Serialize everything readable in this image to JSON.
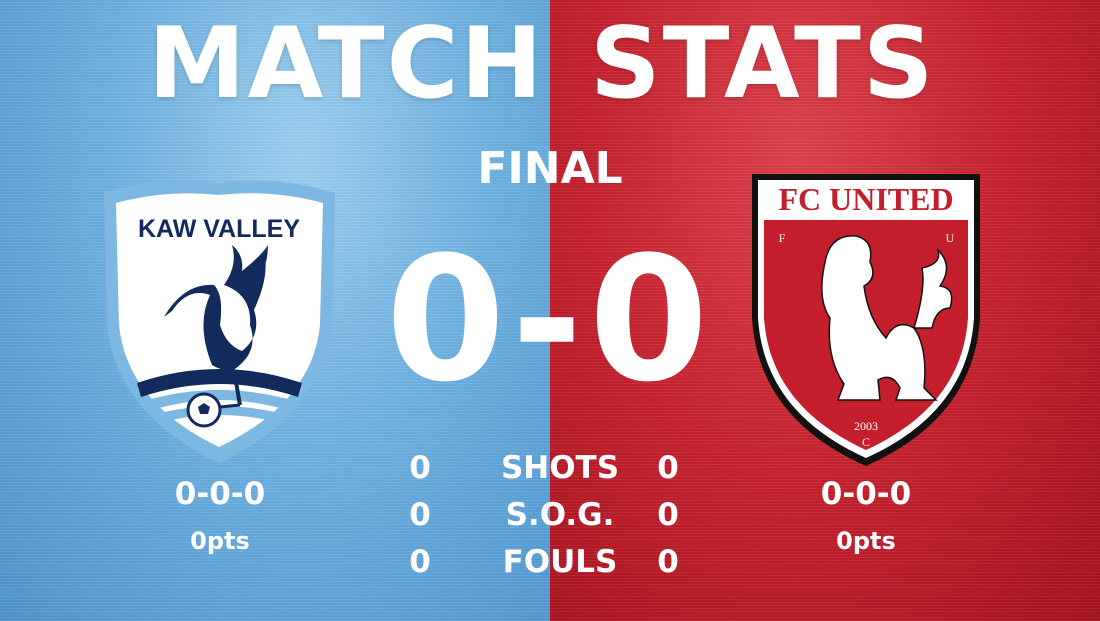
{
  "header": {
    "title_left": "MATCH",
    "title_right": "STATS",
    "status": "FINAL"
  },
  "score": "0-0",
  "home": {
    "crest_text": "KAW VALLEY",
    "record": "0-0-0",
    "points": "0pts",
    "colors": {
      "crest_outline": "#7db8e3",
      "crest_navy": "#132b5c",
      "crest_fill": "#ffffff"
    }
  },
  "away": {
    "crest_text": "FC UNITED",
    "crest_letters": [
      "F",
      "U",
      "C"
    ],
    "crest_year": "2003",
    "record": "0-0-0",
    "points": "0pts",
    "colors": {
      "crest_red": "#c41d2b",
      "crest_fill": "#ffffff",
      "crest_outline": "#111111"
    }
  },
  "stats": [
    {
      "label": "SHOTS",
      "home": "0",
      "away": "0"
    },
    {
      "label": "S.O.G.",
      "home": "0",
      "away": "0"
    },
    {
      "label": "FOULS",
      "home": "0",
      "away": "0"
    }
  ],
  "background_colors": {
    "left": "#6fb2e2",
    "right": "#c8232f"
  }
}
